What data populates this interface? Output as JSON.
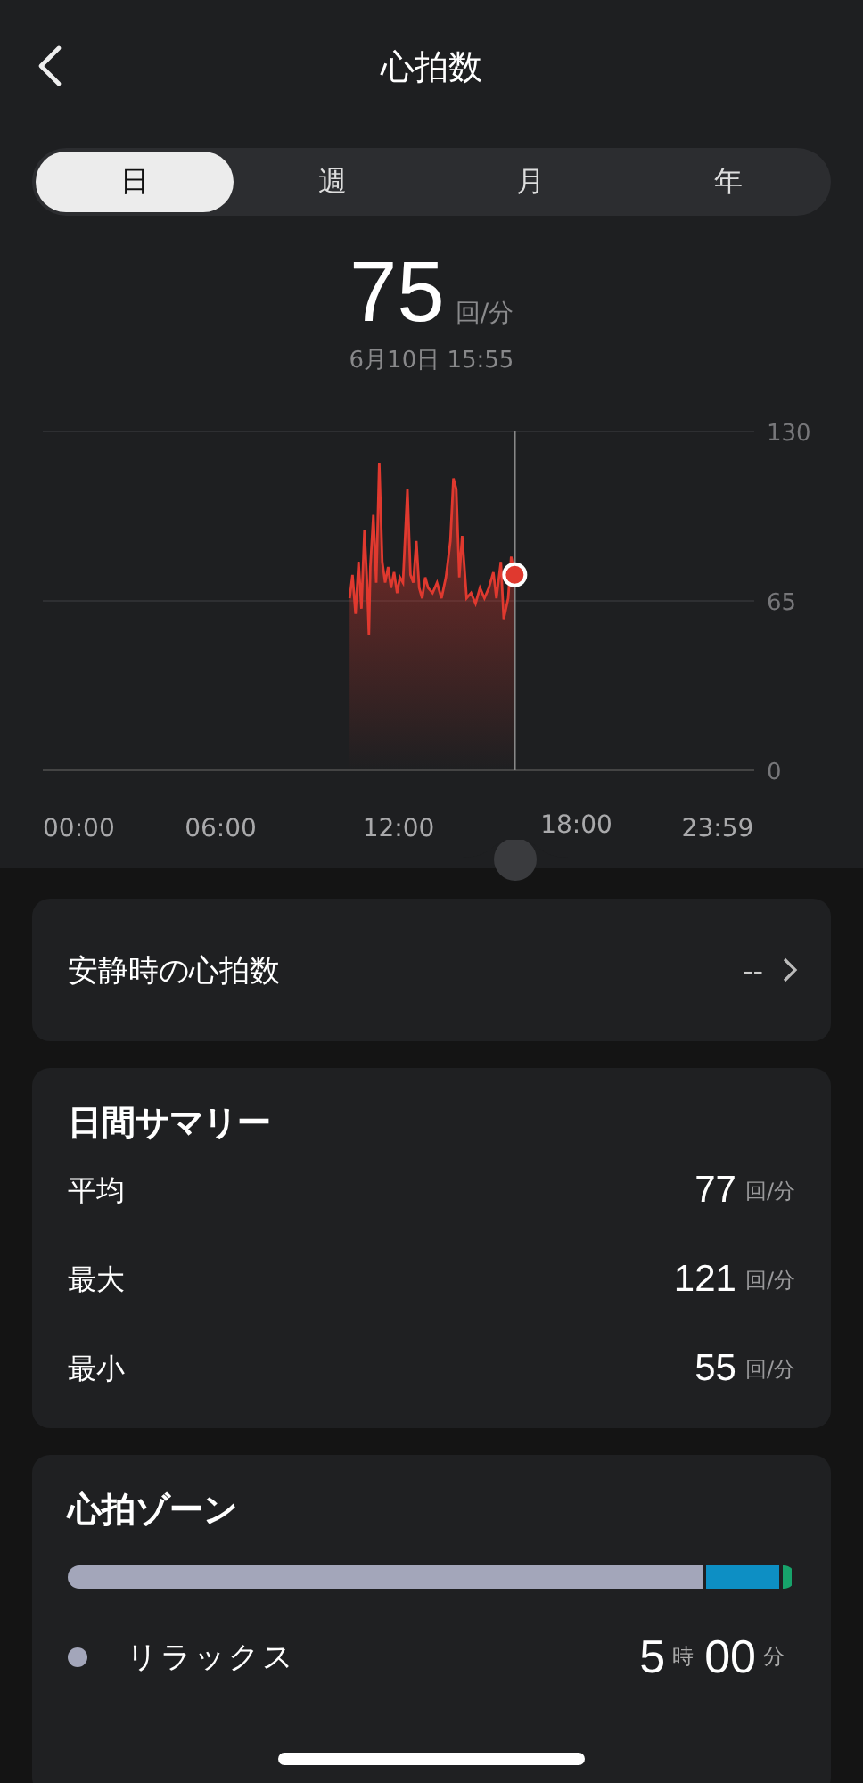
{
  "header": {
    "title": "心拍数"
  },
  "tabs": [
    {
      "label": "日",
      "selected": true
    },
    {
      "label": "週",
      "selected": false
    },
    {
      "label": "月",
      "selected": false
    },
    {
      "label": "年",
      "selected": false
    }
  ],
  "current": {
    "value": "75",
    "unit": "回/分",
    "timestamp": "6月10日 15:55"
  },
  "chart_data": {
    "type": "area",
    "xlim": [
      0,
      24
    ],
    "ylim": [
      0,
      130
    ],
    "yticks": [
      0,
      65,
      130
    ],
    "xticks": [
      {
        "value": 0,
        "label": "00:00"
      },
      {
        "value": 6,
        "label": "06:00"
      },
      {
        "value": 12,
        "label": "12:00"
      },
      {
        "value": 18,
        "label": "18:00"
      },
      {
        "value": 23.98,
        "label": "23:59"
      }
    ],
    "x": [
      10.35,
      10.45,
      10.55,
      10.65,
      10.75,
      10.85,
      10.95,
      11.0,
      11.05,
      11.15,
      11.25,
      11.35,
      11.45,
      11.55,
      11.65,
      11.75,
      11.85,
      11.95,
      12.05,
      12.15,
      12.3,
      12.4,
      12.5,
      12.6,
      12.7,
      12.8,
      12.9,
      13.0,
      13.15,
      13.3,
      13.45,
      13.6,
      13.75,
      13.85,
      13.95,
      14.05,
      14.15,
      14.3,
      14.45,
      14.6,
      14.75,
      14.9,
      15.05,
      15.2,
      15.3,
      15.45,
      15.55,
      15.7,
      15.8,
      15.92
    ],
    "ref_lines": [
      {
        "axis": "x",
        "value": 15.92
      }
    ],
    "series": [
      {
        "color": "#e0392f",
        "values": [
          66,
          75,
          60,
          80,
          62,
          92,
          70,
          52,
          78,
          98,
          72,
          118,
          80,
          72,
          78,
          70,
          76,
          68,
          74,
          72,
          108,
          75,
          72,
          88,
          70,
          66,
          74,
          70,
          68,
          72,
          66,
          74,
          88,
          112,
          108,
          74,
          90,
          66,
          68,
          64,
          70,
          66,
          70,
          76,
          66,
          80,
          58,
          66,
          82,
          75
        ]
      }
    ]
  },
  "resting": {
    "label": "安静時の心拍数",
    "value": "--"
  },
  "summary": {
    "title": "日間サマリー",
    "rows": [
      {
        "label": "平均",
        "value": "77",
        "unit": "回/分"
      },
      {
        "label": "最大",
        "value": "121",
        "unit": "回/分"
      },
      {
        "label": "最小",
        "value": "55",
        "unit": "回/分"
      }
    ]
  },
  "zones": {
    "title": "心拍ゾーン",
    "bar": [
      {
        "color": "#a3a6ba"
      },
      {
        "color": "#0d8fc4"
      },
      {
        "color": "#17a36b"
      }
    ],
    "rows": [
      {
        "name": "リラックス",
        "color": "#a3a6ba",
        "hours": "5",
        "hours_unit": "時",
        "minutes": "00",
        "minutes_unit": "分"
      }
    ]
  }
}
